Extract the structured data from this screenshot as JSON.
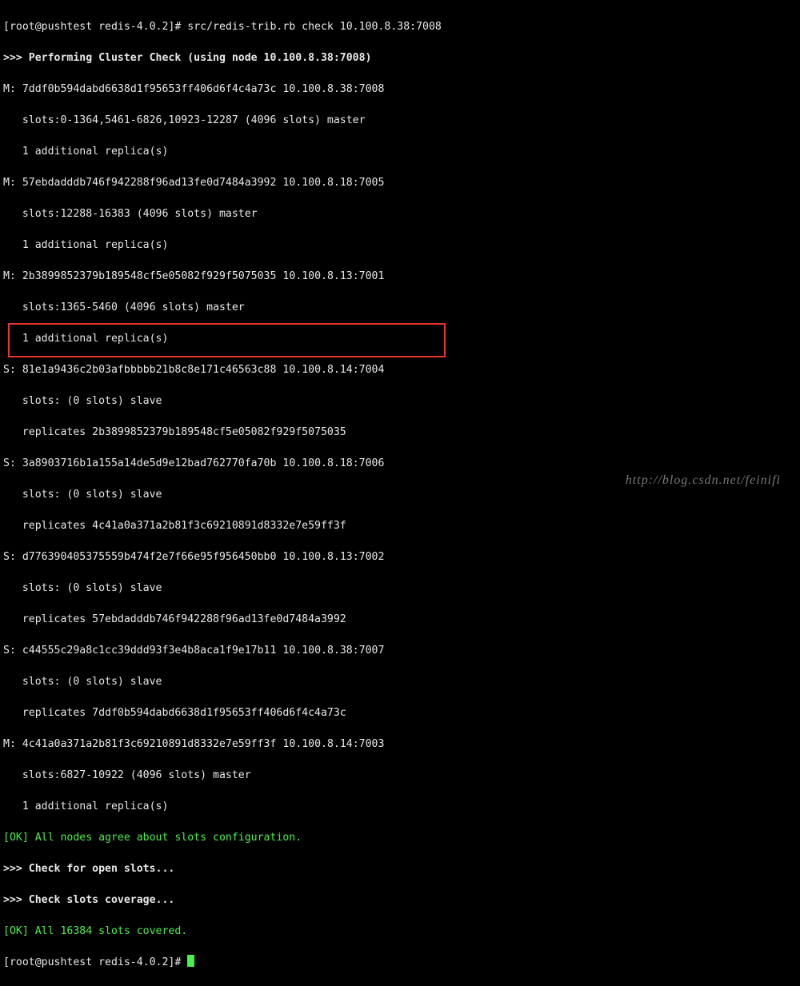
{
  "prompt1_prefix": "[root@pushtest redis-4.0.2]# ",
  "command": "src/redis-trib.rb check 10.100.8.38:7008",
  "header": ">>> Performing Cluster Check (using node 10.100.8.38:7008)",
  "nodes": [
    {
      "tag": "M:",
      "id": "7ddf0b594dabd6638d1f95653ff406d6f4c4a73c",
      "addr": "10.100.8.38:7008",
      "line2": "   slots:0-1364,5461-6826,10923-12287 (4096 slots) master",
      "line3": "   1 additional replica(s)"
    },
    {
      "tag": "M:",
      "id": "57ebdadddb746f942288f96ad13fe0d7484a3992",
      "addr": "10.100.8.18:7005",
      "line2": "   slots:12288-16383 (4096 slots) master",
      "line3": "   1 additional replica(s)"
    },
    {
      "tag": "M:",
      "id": "2b3899852379b189548cf5e05082f929f5075035",
      "addr": "10.100.8.13:7001",
      "line2": "   slots:1365-5460 (4096 slots) master",
      "line3": "   1 additional replica(s)"
    },
    {
      "tag": "S:",
      "id": "81e1a9436c2b03afbbbbb21b8c8e171c46563c88",
      "addr": "10.100.8.14:7004",
      "line2": "   slots: (0 slots) slave",
      "line3": "   replicates 2b3899852379b189548cf5e05082f929f5075035"
    },
    {
      "tag": "S:",
      "id": "3a8903716b1a155a14de5d9e12bad762770fa70b",
      "addr": "10.100.8.18:7006",
      "line2": "   slots: (0 slots) slave",
      "line3": "   replicates 4c41a0a371a2b81f3c69210891d8332e7e59ff3f"
    },
    {
      "tag": "S:",
      "id": "d776390405375559b474f2e7f66e95f956450bb0",
      "addr": "10.100.8.13:7002",
      "line2": "   slots: (0 slots) slave",
      "line3": "   replicates 57ebdadddb746f942288f96ad13fe0d7484a3992"
    },
    {
      "tag": "S:",
      "id": "c44555c29a8c1cc39ddd93f3e4b8aca1f9e17b11",
      "addr": "10.100.8.38:7007",
      "line2": "   slots: (0 slots) slave",
      "line3": "   replicates 7ddf0b594dabd6638d1f95653ff406d6f4c4a73c"
    },
    {
      "tag": "M:",
      "id": "4c41a0a371a2b81f3c69210891d8332e7e59ff3f",
      "addr": "10.100.8.14:7003",
      "line2": "   slots:6827-10922 (4096 slots) master",
      "line3": "   1 additional replica(s)"
    }
  ],
  "ok1": "[OK] All nodes agree about slots configuration.",
  "check_open": ">>> Check for open slots...",
  "check_cov": ">>> Check slots coverage...",
  "ok2": "[OK] All 16384 slots covered.",
  "prompt2": "[root@pushtest redis-4.0.2]# ",
  "watermark": "http://blog.csdn.net/feinifi"
}
